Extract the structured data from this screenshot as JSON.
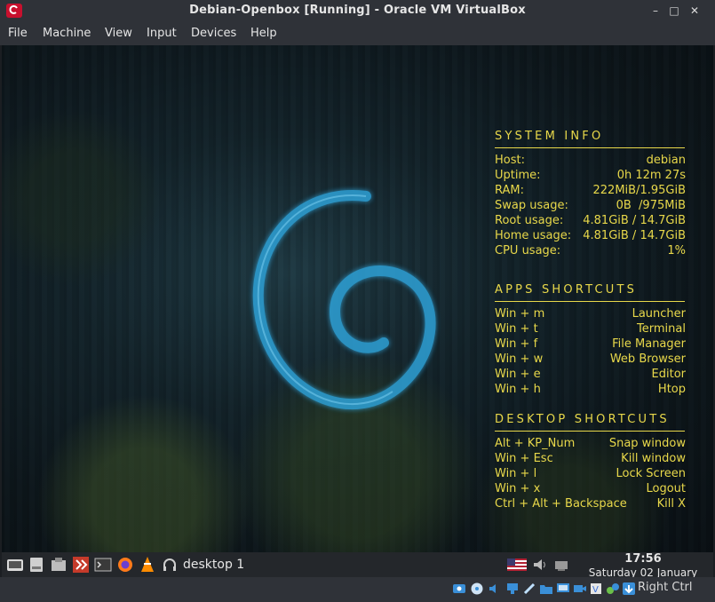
{
  "window": {
    "title": "Debian-Openbox [Running] - Oracle VM VirtualBox",
    "minimize_glyph": "–",
    "maximize_glyph": "□",
    "close_glyph": "✕"
  },
  "menubar": {
    "items": [
      "File",
      "Machine",
      "View",
      "Input",
      "Devices",
      "Help"
    ]
  },
  "conky": {
    "system_info": {
      "title": "SYSTEM INFO",
      "rows": [
        {
          "label": "Host:",
          "value": "debian"
        },
        {
          "label": "Uptime:",
          "value": "0h 12m 27s"
        },
        {
          "label": "RAM:",
          "value": "222MiB/1.95GiB"
        },
        {
          "label": "Swap usage:",
          "value": "0B  /975MiB"
        },
        {
          "label": "Root usage:",
          "value": "4.81GiB / 14.7GiB"
        },
        {
          "label": "Home usage:",
          "value": "4.81GiB / 14.7GiB"
        },
        {
          "label": "CPU usage:",
          "value": "1%"
        }
      ]
    },
    "apps_shortcuts": {
      "title": "APPS SHORTCUTS",
      "rows": [
        {
          "label": "Win + m",
          "value": "Launcher"
        },
        {
          "label": "Win + t",
          "value": "Terminal"
        },
        {
          "label": "Win + f",
          "value": "File Manager"
        },
        {
          "label": "Win + w",
          "value": "Web Browser"
        },
        {
          "label": "Win + e",
          "value": "Editor"
        },
        {
          "label": "Win + h",
          "value": "Htop"
        }
      ]
    },
    "desktop_shortcuts": {
      "title": "DESKTOP SHORTCUTS",
      "rows": [
        {
          "label": "Alt + KP_Num",
          "value": "Snap window"
        },
        {
          "label": "Win + Esc",
          "value": "Kill window"
        },
        {
          "label": "Win + l",
          "value": "Lock Screen"
        },
        {
          "label": "Win + x",
          "value": "Logout"
        },
        {
          "label": "Ctrl + Alt + Backspace",
          "value": "Kill X"
        }
      ]
    }
  },
  "taskbar": {
    "launchers": [
      "keyboard-icon",
      "drive-icon",
      "package-icon",
      "double-commander-icon",
      "terminal-icon",
      "firefox-icon",
      "vlc-icon",
      "headphones-icon"
    ],
    "desktop_label": "desktop 1",
    "tray": [
      "us-flag-icon",
      "volume-icon",
      "network-icon"
    ],
    "clock_time": "17:56",
    "clock_date": "Saturday 02 January"
  },
  "statusbar": {
    "icons": [
      "hard-disk-icon",
      "optical-disk-icon",
      "audio-icon",
      "network-icon",
      "usb-icon",
      "shared-folders-icon",
      "display-icon",
      "video-capture-icon",
      "cpu-icon",
      "mouse-integration-icon",
      "arrow-down-icon"
    ],
    "host_key": "Right Ctrl"
  },
  "colors": {
    "conky_text": "#e8d84a",
    "chrome_bg": "#2f3238",
    "swirl": "#2ea2d8"
  }
}
